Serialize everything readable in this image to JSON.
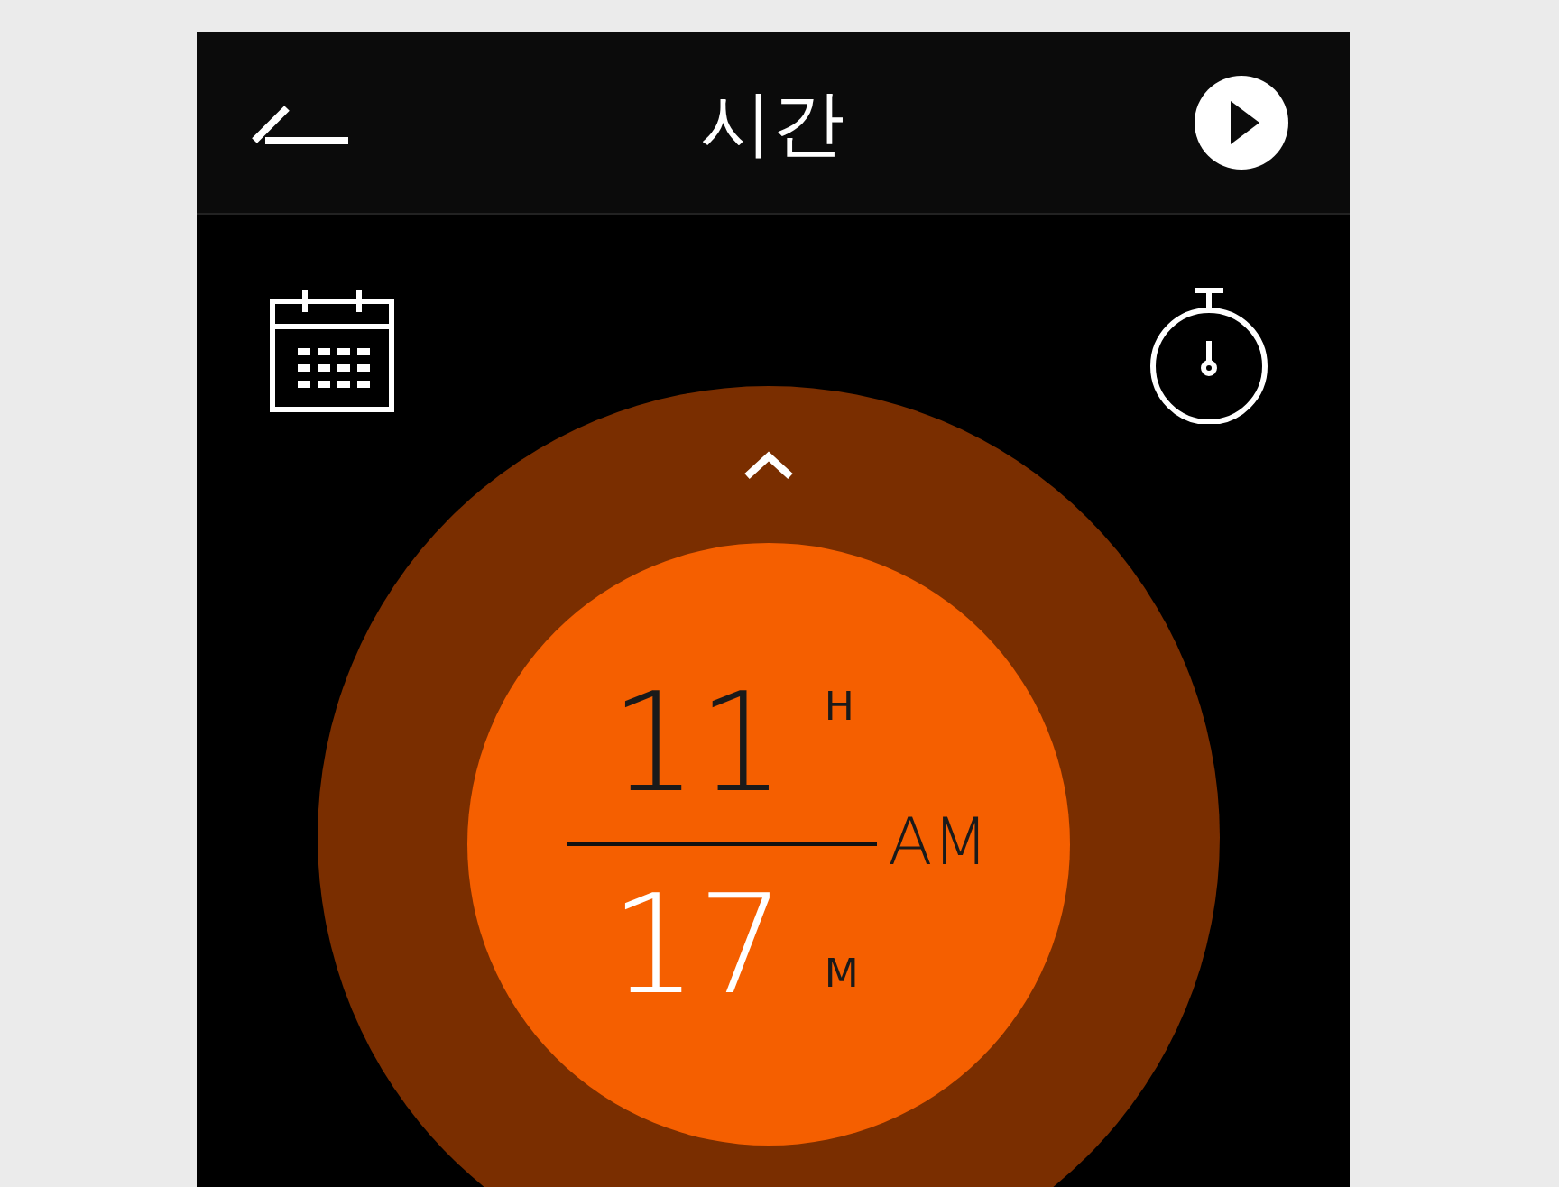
{
  "header": {
    "title": "시간"
  },
  "time": {
    "hour": {
      "value": "11",
      "unit": "H",
      "selected": false
    },
    "minute": {
      "value": "17",
      "unit": "M",
      "selected": true
    },
    "period": "AM"
  }
}
